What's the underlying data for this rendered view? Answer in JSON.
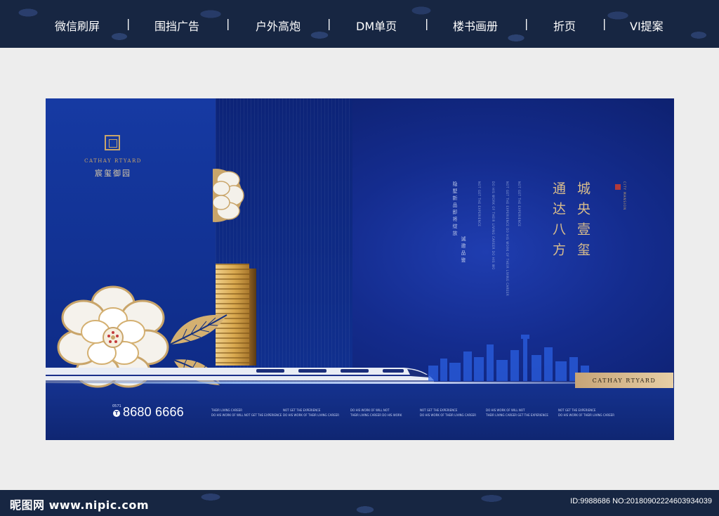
{
  "nav": {
    "items": [
      {
        "label": "微信刷屏"
      },
      {
        "label": "围挡广告"
      },
      {
        "label": "户外高炮"
      },
      {
        "label": "DM单页"
      },
      {
        "label": "楼书画册"
      },
      {
        "label": "折页"
      },
      {
        "label": "VI提案"
      }
    ],
    "separator": "|"
  },
  "artwork": {
    "logo_en": "CATHAY RTYARD",
    "logo_cn": "宸玺御园",
    "headline_col1": "城央壹玺",
    "headline_col2": "通达八方",
    "seal_en": "CITY MANSION",
    "sub_cn_col1": "隐墅新品即将绽放",
    "sub_cn_col2": "诚邀品鉴",
    "sub_en": [
      "NOT GET THE EXPERIENCE",
      "DO HIS WORK OF THEIR LIVING CAREER DO HIS WO",
      "NOT GET THE EXPERIENCE DO HIS WORK OF THEIR LIVING CAREER",
      "NOT GET THE EXPERIENCE"
    ],
    "badge": "CATHAY RTYARD",
    "phone_area": "0571",
    "phone_icon": "T",
    "phone_number": "8680 6666",
    "blurbs": [
      [
        "THEIR LIVING CAREER",
        "DO HIS WORK OF WILL NOT GET THE EXPERIENCE"
      ],
      [
        "NOT GET THE EXPERIENCE",
        "DO HIS WORK OF THEIR LIVING CAREER"
      ],
      [
        "DO HIS WORK OF WILL NOT",
        "THEIR LIVING CAREER DO HIS WORK"
      ],
      [
        "NOT GET THE EXPERIENCE",
        "DO HIS WORK OF THEIR LIVING CAREER"
      ],
      [
        "DO HIS WORK OF WILL NOT",
        "THEIR LIVING CAREER GET THE EXPERIENCE"
      ],
      [
        "NOT GET THE EXPERIENCE",
        "DO HIS WORK OF THEIR LIVING CAREER"
      ]
    ],
    "colors": {
      "navy": "#0b1c63",
      "royal": "#163aa3",
      "gold": "#c9a56a"
    }
  },
  "watermark": {
    "site": "昵图网 www.nipic.com",
    "id": "ID:9988686 NO:20180902224603934039"
  }
}
